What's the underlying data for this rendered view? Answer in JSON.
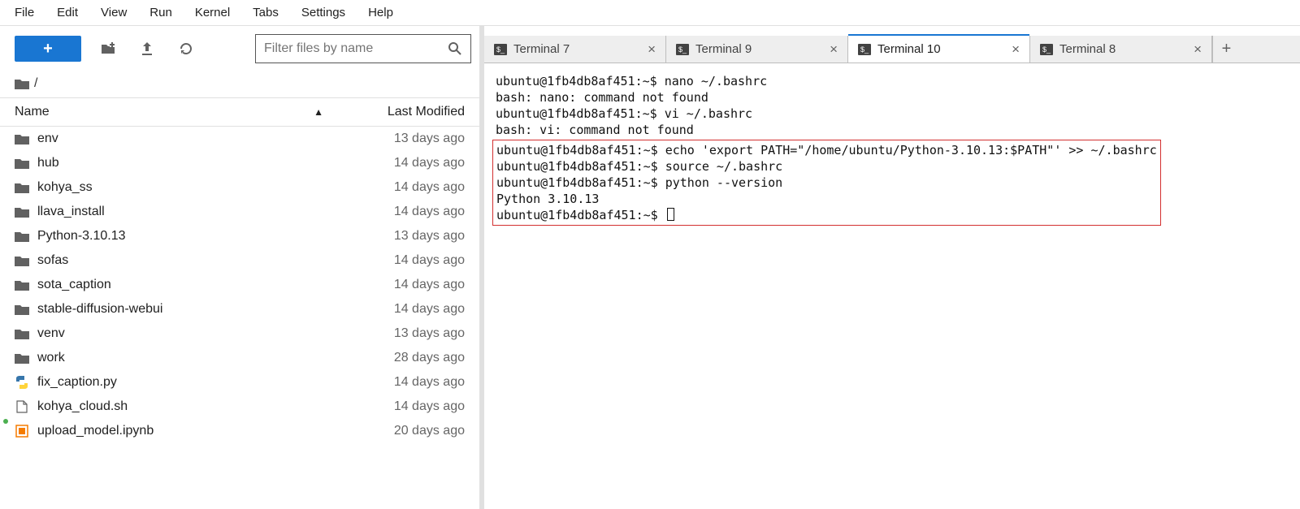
{
  "menubar": [
    "File",
    "Edit",
    "View",
    "Run",
    "Kernel",
    "Tabs",
    "Settings",
    "Help"
  ],
  "toolbar": {
    "filter_placeholder": "Filter files by name"
  },
  "breadcrumb": {
    "path": "/"
  },
  "file_header": {
    "name_label": "Name",
    "mod_label": "Last Modified"
  },
  "files": [
    {
      "icon": "folder",
      "name": "env",
      "modified": "13 days ago",
      "running": false
    },
    {
      "icon": "folder",
      "name": "hub",
      "modified": "14 days ago",
      "running": false
    },
    {
      "icon": "folder",
      "name": "kohya_ss",
      "modified": "14 days ago",
      "running": false
    },
    {
      "icon": "folder",
      "name": "llava_install",
      "modified": "14 days ago",
      "running": false
    },
    {
      "icon": "folder",
      "name": "Python-3.10.13",
      "modified": "13 days ago",
      "running": false
    },
    {
      "icon": "folder",
      "name": "sofas",
      "modified": "14 days ago",
      "running": false
    },
    {
      "icon": "folder",
      "name": "sota_caption",
      "modified": "14 days ago",
      "running": false
    },
    {
      "icon": "folder",
      "name": "stable-diffusion-webui",
      "modified": "14 days ago",
      "running": false
    },
    {
      "icon": "folder",
      "name": "venv",
      "modified": "13 days ago",
      "running": false
    },
    {
      "icon": "folder",
      "name": "work",
      "modified": "28 days ago",
      "running": false
    },
    {
      "icon": "python",
      "name": "fix_caption.py",
      "modified": "14 days ago",
      "running": false
    },
    {
      "icon": "file",
      "name": "kohya_cloud.sh",
      "modified": "14 days ago",
      "running": false
    },
    {
      "icon": "notebook",
      "name": "upload_model.ipynb",
      "modified": "20 days ago",
      "running": true
    }
  ],
  "tabs": [
    {
      "label": "Terminal 7",
      "active": false
    },
    {
      "label": "Terminal 9",
      "active": false
    },
    {
      "label": "Terminal 10",
      "active": true
    },
    {
      "label": "Terminal 8",
      "active": false
    }
  ],
  "terminal": {
    "prompt": "ubuntu@1fb4db8af451:~$ ",
    "plain_lines": [
      "ubuntu@1fb4db8af451:~$ nano ~/.bashrc",
      "bash: nano: command not found",
      "ubuntu@1fb4db8af451:~$ vi ~/.bashrc",
      "bash: vi: command not found"
    ],
    "highlight_lines": [
      "ubuntu@1fb4db8af451:~$ echo 'export PATH=\"/home/ubuntu/Python-3.10.13:$PATH\"' >> ~/.bashrc",
      "ubuntu@1fb4db8af451:~$ source ~/.bashrc",
      "ubuntu@1fb4db8af451:~$ python --version",
      "Python 3.10.13",
      "ubuntu@1fb4db8af451:~$ "
    ]
  }
}
